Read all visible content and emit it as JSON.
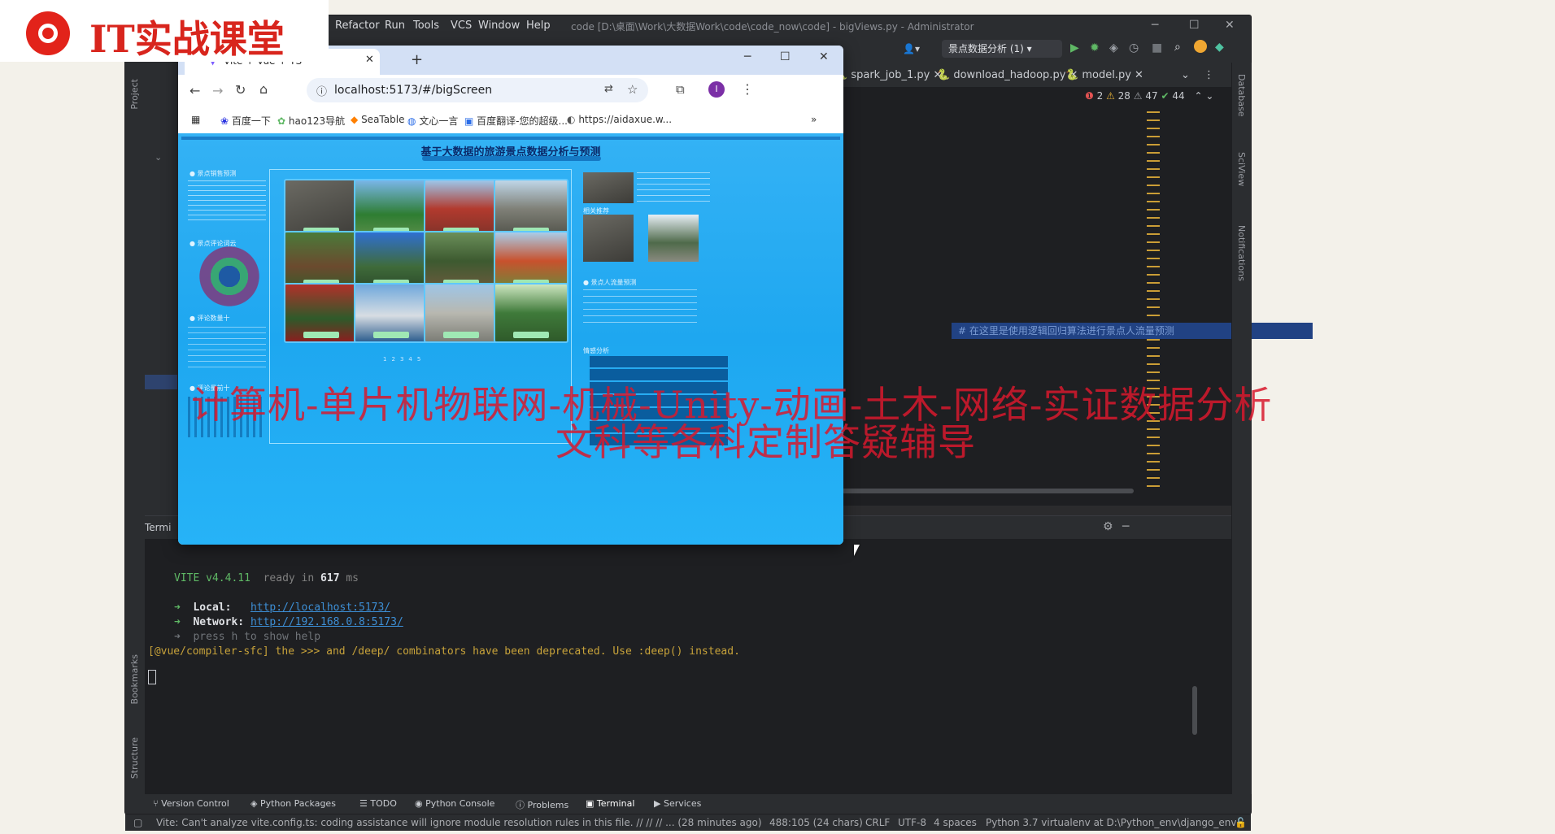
{
  "logo": {
    "brand_text": "IT实战课堂"
  },
  "ide": {
    "menus": [
      "Refactor",
      "Run",
      "Tools",
      "VCS",
      "Window",
      "Help"
    ],
    "title": "code [D:\\桌面\\Work\\大数据Work\\code\\code_now\\code] - bigViews.py - Administrator",
    "run_config": "景点数据分析 (1)",
    "file_tabs": [
      "spark_job_1.py",
      "download_hadoop.py",
      "model.py"
    ],
    "inspections": {
      "errors": "2",
      "warnings": "28",
      "weak": "47",
      "ok": "44"
    },
    "comment": "# 在这里是使用逻辑回归算法进行景点人流量预测",
    "left_tools": [
      "Project",
      "Bookmarks",
      "Structure"
    ],
    "right_tools": [
      "Database",
      "SciView",
      "Notifications"
    ],
    "terminal": {
      "header": "Termi",
      "lines": [
        {
          "label": "VITE",
          "version": "v4.4.11",
          "text": "ready in",
          "ms": "617",
          "unit": "ms"
        },
        {
          "label": "Local:",
          "url": "http://localhost:5173/"
        },
        {
          "label": "Network:",
          "url": "http://192.168.0.8:5173/"
        },
        {
          "text": "press h to show help"
        }
      ],
      "warning_tag": "[@vue/compiler-sfc]",
      "warning": " the >>> and /deep/ combinators have been deprecated. Use :deep() instead."
    },
    "bottom_tools": [
      "Version Control",
      "Python Packages",
      "TODO",
      "Python Console",
      "Problems",
      "Terminal",
      "Services"
    ],
    "status": {
      "message": "Vite: Can't analyze vite.config.ts: coding assistance will ignore module resolution rules in this file. // // // ... (28 minutes ago)",
      "position": "488:105 (24 chars)",
      "line_sep": "CRLF",
      "encoding": "UTF-8",
      "indent": "4 spaces",
      "interpreter": "Python 3.7 virtualenv at D:\\Python_env\\django_env"
    }
  },
  "browser": {
    "tab_title": "Vite + Vue + TS",
    "url": "localhost:5173/#/bigScreen",
    "bookmarks": [
      "百度一下",
      "hao123导航",
      "SeaTable",
      "文心一言",
      "百度翻译-您的超级...",
      "https://aidaxue.w..."
    ],
    "page": {
      "title": "基于大数据的旅游景点数据分析与预测",
      "left_panels": [
        "景点销售预测",
        "景点评论词云",
        "评论数量十",
        "评论量前十"
      ],
      "right_panels": [
        "相关推荐",
        "景点人流量预测",
        "情感分析"
      ],
      "pager": [
        "1",
        "2",
        "3",
        "4",
        "5"
      ]
    }
  },
  "watermark": {
    "line1": "计算机-单片机物联网-机械-Unity-动画-土木-网络-实证数据分析",
    "line2": "文科等各科定制答疑辅导"
  }
}
